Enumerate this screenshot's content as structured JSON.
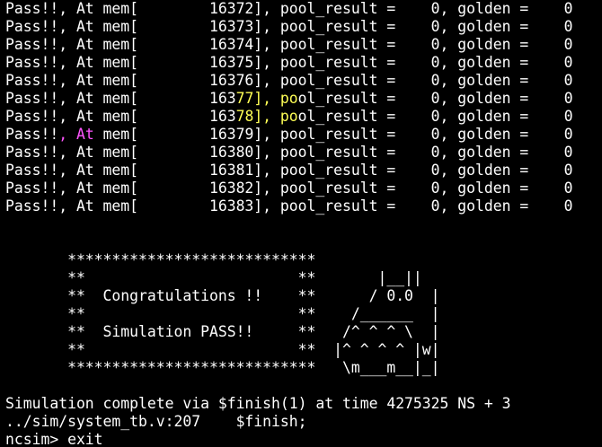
{
  "pass_lines": [
    {
      "prefix": "Pass!!, At mem[",
      "addr": "16372",
      "result": "0",
      "golden": "0"
    },
    {
      "prefix": "Pass!!, At mem[",
      "addr": "16373",
      "result": "0",
      "golden": "0"
    },
    {
      "prefix": "Pass!!, At mem[",
      "addr": "16374",
      "result": "0",
      "golden": "0"
    },
    {
      "prefix": "Pass!!, At mem[",
      "addr": "16375",
      "result": "0",
      "golden": "0"
    },
    {
      "prefix": "Pass!!, At mem[",
      "addr": "16376",
      "result": "0",
      "golden": "0"
    },
    {
      "prefix": "Pass!!, At mem[",
      "addr": "16377",
      "result": "0",
      "golden": "0"
    },
    {
      "prefix": "Pass!!, At mem[",
      "addr": "16378",
      "result": "0",
      "golden": "0"
    },
    {
      "prefix": "Pass!!, At mem[",
      "addr": "16379",
      "result": "0",
      "golden": "0"
    },
    {
      "prefix": "Pass!!, At mem[",
      "addr": "16380",
      "result": "0",
      "golden": "0"
    },
    {
      "prefix": "Pass!!, At mem[",
      "addr": "16381",
      "result": "0",
      "golden": "0"
    },
    {
      "prefix": "Pass!!, At mem[",
      "addr": "16382",
      "result": "0",
      "golden": "0"
    },
    {
      "prefix": "Pass!!, At mem[",
      "addr": "16383",
      "result": "0",
      "golden": "0"
    }
  ],
  "labels": {
    "pool_result": "pool_result =",
    "golden": "golden ="
  },
  "banner": {
    "lines": [
      "       ****************************",
      "       **                        **       |__||",
      "       **  Congratulations !!    **      / 0.0  |",
      "       **                        **    /______  |",
      "       **  Simulation PASS!!     **   /^ ^ ^ \\  |",
      "       **                        **  |^ ^ ^ ^ |w|",
      "       ****************************   \\m___m__|_|"
    ]
  },
  "footer": {
    "complete": "Simulation complete via $finish(1) at time 4275325 NS + 3",
    "location": "../sim/system_tb.v:207    $finish;",
    "prompt": "ncsim> exit"
  },
  "colors": {
    "background": "#000000",
    "text": "#ffffff",
    "highlight_yellow": "#ffff55",
    "highlight_magenta": "#ff55ff"
  }
}
